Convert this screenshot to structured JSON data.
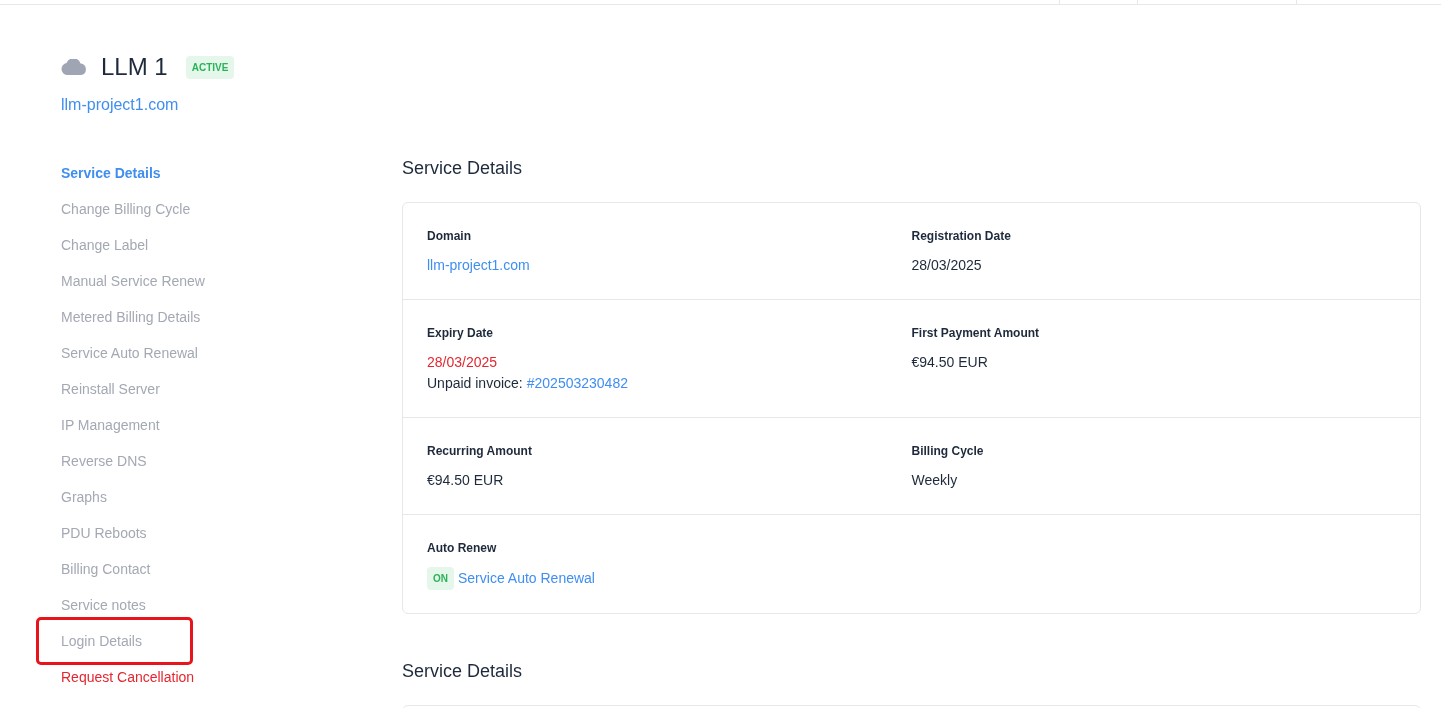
{
  "service": {
    "name": "LLM 1",
    "status": "ACTIVE",
    "domain": "llm-project1.com"
  },
  "sidebar": {
    "items": [
      {
        "label": "Service Details",
        "kind": "link",
        "selected": true,
        "highlighted": false
      },
      {
        "label": "Change Billing Cycle",
        "kind": "link",
        "selected": false,
        "highlighted": false
      },
      {
        "label": "Change Label",
        "kind": "link",
        "selected": false,
        "highlighted": false
      },
      {
        "label": "Manual Service Renew",
        "kind": "link",
        "selected": false,
        "highlighted": false
      },
      {
        "label": "Metered Billing Details",
        "kind": "link",
        "selected": false,
        "highlighted": false
      },
      {
        "label": "Service Auto Renewal",
        "kind": "link",
        "selected": false,
        "highlighted": false
      },
      {
        "label": "Reinstall Server",
        "kind": "link",
        "selected": false,
        "highlighted": false
      },
      {
        "label": "IP Management",
        "kind": "link",
        "selected": false,
        "highlighted": false
      },
      {
        "label": "Reverse DNS",
        "kind": "link",
        "selected": false,
        "highlighted": false
      },
      {
        "label": "Graphs",
        "kind": "link",
        "selected": false,
        "highlighted": false
      },
      {
        "label": "PDU Reboots",
        "kind": "link",
        "selected": false,
        "highlighted": false
      },
      {
        "label": "Billing Contact",
        "kind": "link",
        "selected": false,
        "highlighted": false
      },
      {
        "label": "Service notes",
        "kind": "link",
        "selected": false,
        "highlighted": false
      },
      {
        "label": "Login Details",
        "kind": "link",
        "selected": false,
        "highlighted": true
      },
      {
        "label": "Request Cancellation",
        "kind": "danger",
        "selected": false,
        "highlighted": false
      }
    ]
  },
  "sections": [
    {
      "title": "Service Details",
      "rows": [
        [
          {
            "label": "Domain",
            "kind": "link",
            "value": "llm-project1.com"
          },
          {
            "label": "Registration Date",
            "kind": "text",
            "value": "28/03/2025"
          }
        ],
        [
          {
            "label": "Expiry Date",
            "kind": "overdue",
            "value": "28/03/2025",
            "note": "Unpaid invoice:",
            "note_link": "#202503230482"
          },
          {
            "label": "First Payment Amount",
            "kind": "text",
            "value": "€94.50 EUR"
          }
        ],
        [
          {
            "label": "Recurring Amount",
            "kind": "text",
            "value": "€94.50 EUR"
          },
          {
            "label": "Billing Cycle",
            "kind": "text",
            "value": "Weekly"
          }
        ],
        [
          {
            "label": "Auto Renew",
            "kind": "toggle",
            "on": true,
            "badge": "ON",
            "value": "Service Auto Renewal"
          }
        ]
      ]
    },
    {
      "title": "Service Details"
    }
  ]
}
